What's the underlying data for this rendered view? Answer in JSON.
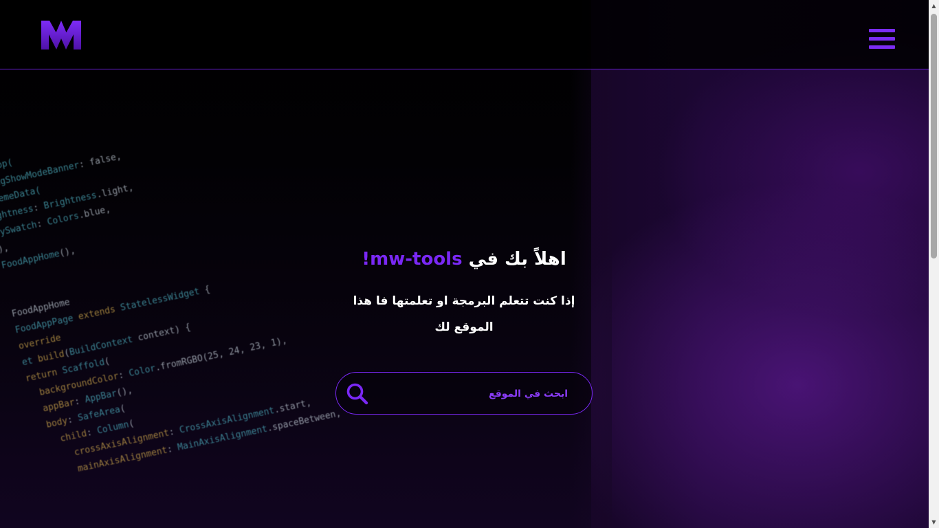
{
  "app": {
    "logo_alt": "MW",
    "accent_color": "#7a28f5"
  },
  "header": {
    "menu_icon": "hamburger-menu-icon"
  },
  "hero": {
    "headline_prefix": "اهلاً بك في",
    "brand": "mw-tools",
    "headline_suffix": "!",
    "subtitle": "إذا كنت تتعلم البرمجة او تعلمتها فا هذا الموقع لك"
  },
  "search": {
    "placeholder": "ابحث في الموقع",
    "value": "",
    "icon": "search-icon"
  }
}
